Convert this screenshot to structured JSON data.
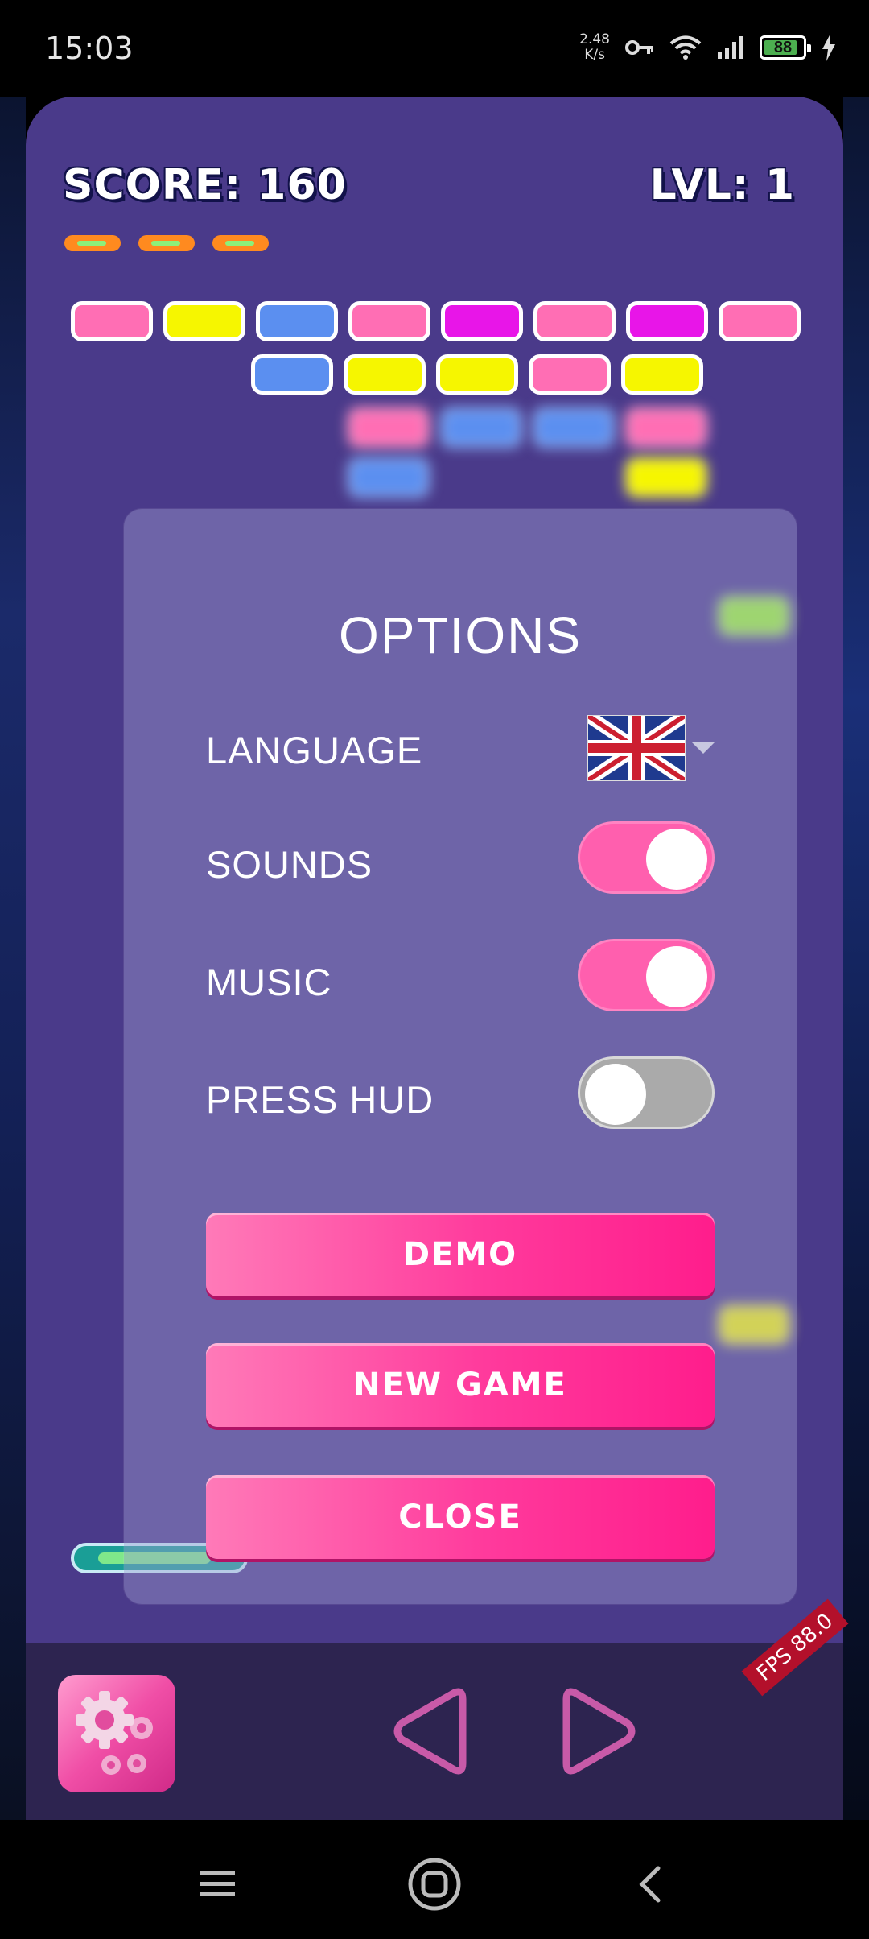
{
  "status_bar": {
    "time": "15:03",
    "net_speed": "2.48",
    "net_unit": "K/s",
    "battery": "88",
    "battery_level": 0.88
  },
  "hud": {
    "score_text": "SCORE: 160",
    "level_text": "LVL: 1",
    "lives": 3
  },
  "bricks": {
    "colors": {
      "pink": "#ff6eb4",
      "yellow": "#f6f600",
      "blue": "#5b8ff0",
      "magenta": "#e815e8",
      "lime": "#9dfb2a"
    },
    "rows": [
      [
        "pink",
        "yellow",
        "blue",
        "pink",
        "magenta",
        "pink",
        "magenta",
        "pink"
      ],
      [
        "blue",
        "yellow",
        "yellow",
        "pink",
        "yellow"
      ]
    ]
  },
  "options": {
    "title": "OPTIONS",
    "language_label": "LANGUAGE",
    "sounds_label": "SOUNDS",
    "music_label": "MUSIC",
    "press_hud_label": "PRESS HUD",
    "sounds_on": true,
    "music_on": true,
    "press_hud_on": false,
    "demo_button": "DEMO",
    "new_game_button": "NEW GAME",
    "close_button": "CLOSE"
  },
  "controls": {
    "fps_text": "FPS 88.0"
  },
  "accent_colors": {
    "button_pink": "#ff3a9c",
    "toggle_on": "#ff5fae",
    "toggle_off": "#aaaaaa",
    "game_bg": "#4a3a8a"
  }
}
